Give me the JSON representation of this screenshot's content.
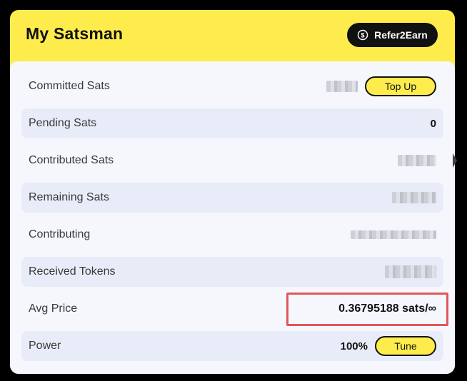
{
  "card": {
    "title": "My Satsman",
    "refer_button": {
      "label": "Refer2Earn",
      "icon": "dollar-coin-icon"
    }
  },
  "rows": [
    {
      "label": "Committed Sats",
      "value": "",
      "redacted": true,
      "action": "Top Up"
    },
    {
      "label": "Pending Sats",
      "value": "0"
    },
    {
      "label": "Contributed Sats",
      "value": "",
      "redacted": true
    },
    {
      "label": "Remaining Sats",
      "value": "",
      "redacted": true
    },
    {
      "label": "Contributing",
      "value": "",
      "redacted": true
    },
    {
      "label": "Received Tokens",
      "value": "",
      "redacted": true
    },
    {
      "label": "Avg Price",
      "value": "0.36795188 sats/∞",
      "highlighted": true
    },
    {
      "label": "Power",
      "value": "100%",
      "action": "Tune"
    }
  ],
  "colors": {
    "brand_yellow": "#fdec4b",
    "panel_bg": "#f5f7fd",
    "alt_row_bg": "#e8ecf8",
    "highlight_border": "#e0585a"
  }
}
